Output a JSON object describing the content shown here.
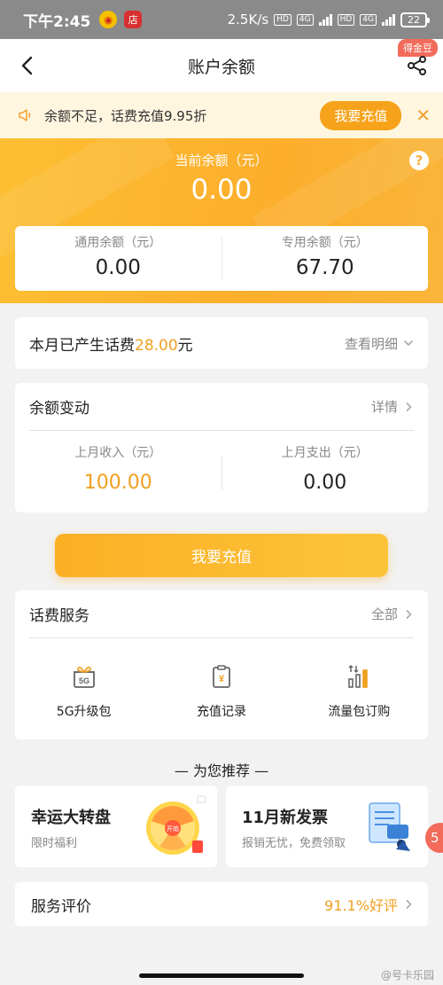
{
  "status_bar": {
    "time": "下午2:45",
    "net_speed": "2.5K/s",
    "hd1": "HD",
    "sig1": "4G",
    "hd2": "HD",
    "sig2": "4G",
    "battery": "22"
  },
  "nav": {
    "title": "账户余额",
    "badge": "得金豆"
  },
  "notice": {
    "text": "余额不足，话费充值9.95折",
    "button": "我要充值"
  },
  "balance": {
    "label": "当前余额（元）",
    "value": "0.00",
    "general_label": "通用余额（元）",
    "general_value": "0.00",
    "special_label": "专用余额（元）",
    "special_value": "67.70"
  },
  "month_fee": {
    "prefix": "本月已产生话费",
    "amount": "28.00",
    "suffix": "元",
    "link": "查看明细"
  },
  "balance_change": {
    "title": "余额变动",
    "link": "详情",
    "income_label": "上月收入（元）",
    "income_value": "100.00",
    "expense_label": "上月支出（元）",
    "expense_value": "0.00"
  },
  "recharge_button": "我要充值",
  "fee_service": {
    "title": "话费服务",
    "link": "全部",
    "items": [
      {
        "label": "5G升级包",
        "icon": "5g-gift-icon"
      },
      {
        "label": "充值记录",
        "icon": "recharge-record-icon"
      },
      {
        "label": "流量包订购",
        "icon": "data-package-icon"
      }
    ]
  },
  "recommend_title": "— 为您推荐 —",
  "promos": [
    {
      "title": "幸运大转盘",
      "subtitle": "限时福利",
      "art_label": "开始"
    },
    {
      "title": "11月新发票",
      "subtitle": "报销无忧，免费领取"
    }
  ],
  "float_button": "5",
  "rating": {
    "title": "服务评价",
    "value": "91.1%好评"
  },
  "watermark": "@号卡乐园",
  "colors": {
    "accent": "#f6a31b",
    "highlight": "#f0a020",
    "hero": "#fcae2c"
  }
}
